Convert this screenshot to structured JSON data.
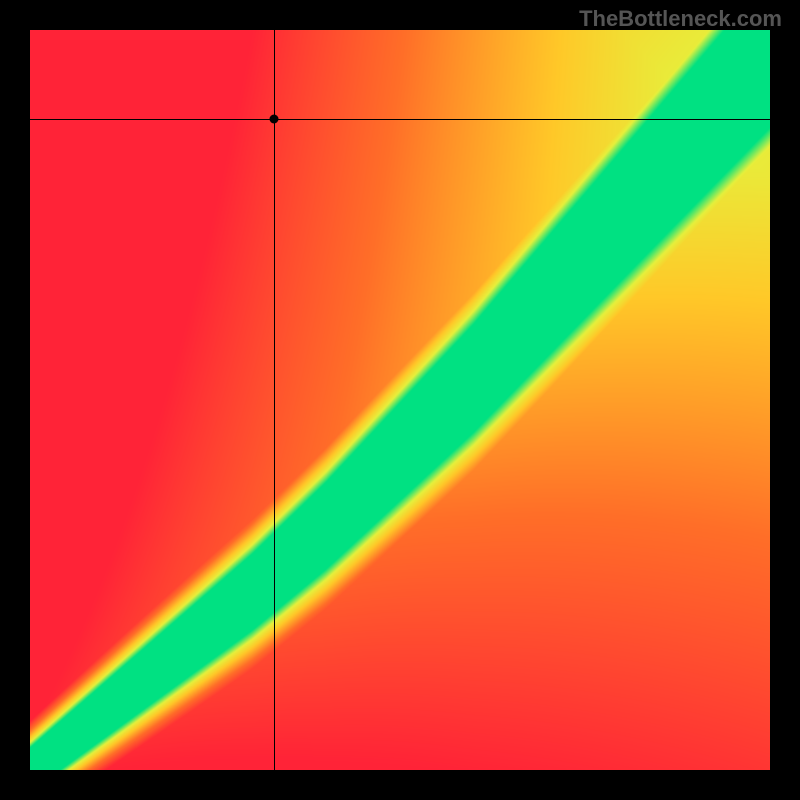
{
  "watermark": "TheBottleneck.com",
  "chart_data": {
    "type": "heatmap",
    "title": "",
    "xlabel": "",
    "ylabel": "",
    "xlim": [
      0,
      100
    ],
    "ylim": [
      0,
      100
    ],
    "marker": {
      "x": 33,
      "y": 88
    },
    "colorscale_description": "Red-orange-yellow-green performance gradient. Green diagonal band indicates balanced/optimal match; red regions indicate bottleneck.",
    "optimal_band": {
      "description": "Green band roughly along y ≈ x with slight S-curve, widening toward upper-right.",
      "approx_center_line": [
        {
          "x": 0,
          "y": 0
        },
        {
          "x": 10,
          "y": 8
        },
        {
          "x": 20,
          "y": 16
        },
        {
          "x": 30,
          "y": 24
        },
        {
          "x": 40,
          "y": 33
        },
        {
          "x": 50,
          "y": 43
        },
        {
          "x": 60,
          "y": 53
        },
        {
          "x": 70,
          "y": 64
        },
        {
          "x": 80,
          "y": 75
        },
        {
          "x": 90,
          "y": 86
        },
        {
          "x": 100,
          "y": 97
        }
      ],
      "approx_half_width": 6
    }
  }
}
